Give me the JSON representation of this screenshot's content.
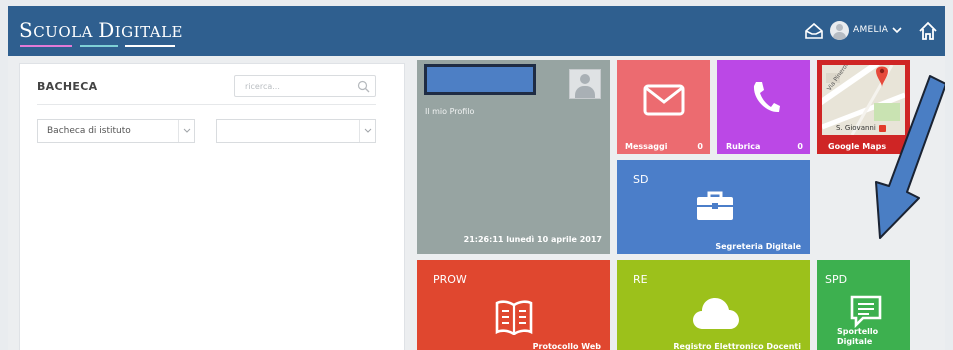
{
  "header": {
    "logo_first_big": "S",
    "logo_first_small": "CUOLA ",
    "logo_second_big": "D",
    "logo_second_small": "IGITALE",
    "username": "AMELIA",
    "bar_color": "#2f5f8f",
    "logo_line_colors": [
      "#e27ad6",
      "#7fd0d6",
      "#ffffff"
    ]
  },
  "bacheca": {
    "title": "BACHECA",
    "search_placeholder": "ricerca...",
    "select_scope": "Bacheca di istituto",
    "select_filter": ""
  },
  "tiles": {
    "profile": {
      "label": "Il mio Profilo",
      "datetime": "21:26:11 lunedì 10 aprile 2017",
      "color": "#97a4a2"
    },
    "messages": {
      "label": "Messaggi",
      "count": "0",
      "color": "#ec6b70"
    },
    "contacts": {
      "label": "Rubrica",
      "count": "0",
      "color": "#bb48e6"
    },
    "maps": {
      "label": "Google Maps",
      "map_place": "S. Giovanni",
      "map_street": "Via Pinerolo",
      "color": "#cf2525"
    },
    "secretariat": {
      "abbr": "SD",
      "label": "Segreteria Digitale",
      "color": "#4b7ec9"
    },
    "protocol": {
      "abbr": "PROW",
      "label": "Protocollo Web",
      "color": "#e0472f"
    },
    "register": {
      "abbr": "RE",
      "label": "Registro Elettronico Docenti",
      "color": "#9cc11b"
    },
    "desk": {
      "abbr": "SPD",
      "label_line1": "Sportello",
      "label_line2": "Digitale",
      "color": "#3db04f"
    }
  },
  "annotation": {
    "arrow_color": "#4a7ec4"
  }
}
